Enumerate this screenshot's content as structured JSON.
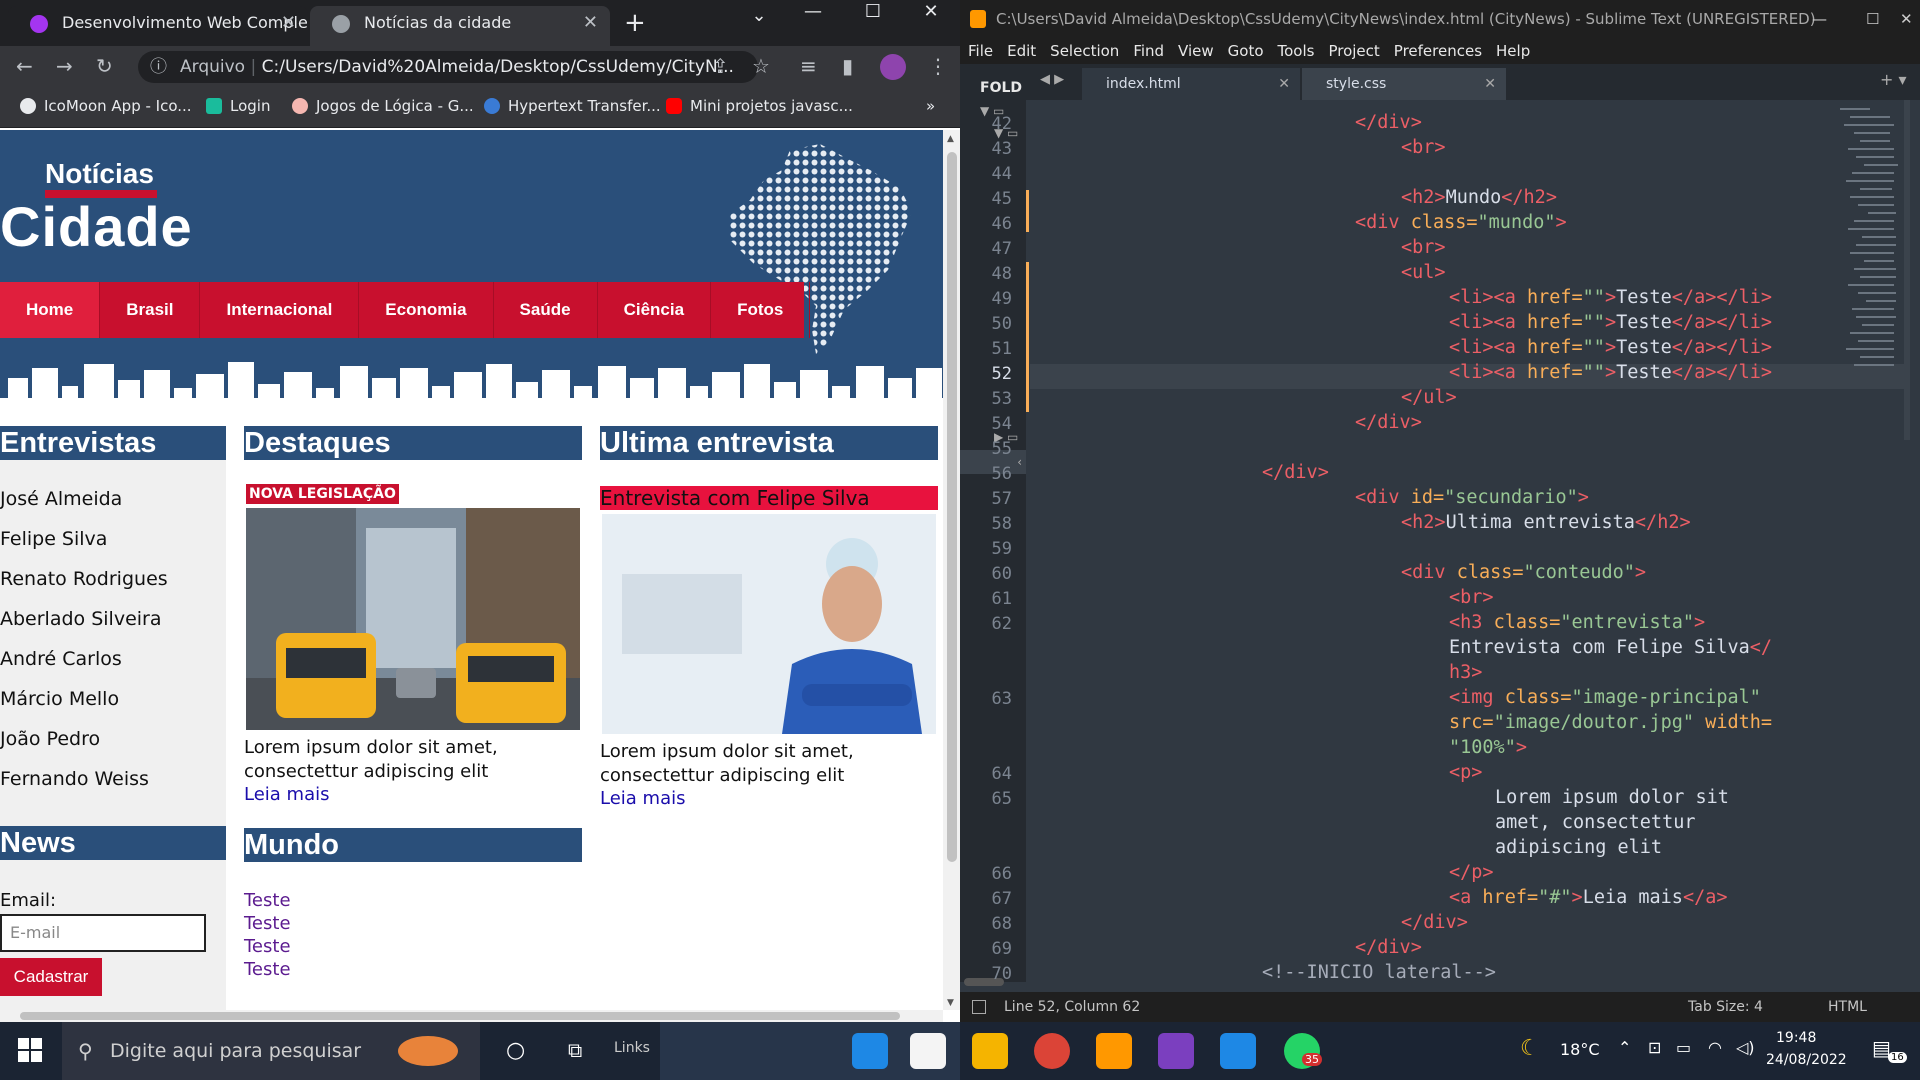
{
  "browser": {
    "tabs": [
      {
        "title": "Desenvolvimento Web Completo"
      },
      {
        "title": "Notícias da cidade"
      }
    ],
    "address": {
      "label": "Arquivo",
      "url": "C:/Users/David%20Almeida/Desktop/CssUdemy/CityN..."
    },
    "bookmarks": [
      "IcoMoon App - Ico...",
      "Login",
      "Jogos de Lógica - G...",
      "Hypertext Transfer...",
      "Mini projetos javasc..."
    ]
  },
  "site": {
    "logo_top": "Notícias",
    "logo_bottom": "Cidade",
    "nav": [
      "Home",
      "Brasil",
      "Internacional",
      "Economia",
      "Saúde",
      "Ciência",
      "Fotos"
    ],
    "entrevistas": {
      "title": "Entrevistas",
      "names": [
        "José Almeida",
        "Felipe Silva",
        "Renato Rodrigues",
        "Aberlado Silveira",
        "André Carlos",
        "Márcio Mello",
        "João Pedro",
        "Fernando Weiss"
      ]
    },
    "news": {
      "title": "News",
      "email_label": "Email:",
      "email_placeholder": "E-mail",
      "button": "Cadastrar"
    },
    "destaques": {
      "title": "Destaques",
      "tag": "NOVA LEGISLAÇÃO",
      "lorem_1": "Lorem ipsum dolor sit amet,",
      "lorem_2": "consectettur adipiscing elit",
      "more": "Leia mais"
    },
    "mundo": {
      "title": "Mundo",
      "items": [
        "Teste",
        "Teste",
        "Teste",
        "Teste"
      ]
    },
    "ultima": {
      "title": "Ultima entrevista",
      "tag": "Entrevista com Felipe Silva",
      "lorem_1": "Lorem ipsum dolor sit amet,",
      "lorem_2": "consectettur adipiscing elit",
      "more": "Leia mais"
    }
  },
  "editor": {
    "title": "C:\\Users\\David Almeida\\Desktop\\CssUdemy\\CityNews\\index.html (CityNews) - Sublime Text (UNREGISTERED)",
    "menu": [
      "File",
      "Edit",
      "Selection",
      "Find",
      "View",
      "Goto",
      "Tools",
      "Project",
      "Preferences",
      "Help"
    ],
    "sidebar_label": "FOLD",
    "tabs": [
      "index.html",
      "style.css"
    ],
    "status_left": "Line 52, Column 62",
    "tab_size": "Tab Size: 4",
    "syntax": "HTML",
    "line_numbers": [
      "42",
      "43",
      "44",
      "45",
      "46",
      "47",
      "48",
      "49",
      "50",
      "51",
      "52",
      "53",
      "54",
      "55",
      "56",
      "57",
      "58",
      "59",
      "60",
      "61",
      "62",
      "",
      "63",
      "",
      "64",
      "65",
      "",
      "",
      "66",
      "67",
      "68",
      "69",
      "70"
    ],
    "lines": {
      "l42": "</div>",
      "l43": "<br>",
      "l45a": "<h2>",
      "l45b": "Mundo",
      "l45c": "</h2>",
      "l46a": "<div ",
      "l46b": "class=",
      "l46c": "\"mundo\"",
      "l46d": ">",
      "l47": "<br>",
      "l48": "<ul>",
      "li_a": "<li><a ",
      "li_b": "href=",
      "li_c": "\"\"",
      "li_d": ">",
      "li_e": "Teste",
      "li_f": "</a></li>",
      "l53": "</ul>",
      "l54": "</div>",
      "l56": "</div>",
      "l57a": "<div ",
      "l57b": "id=",
      "l57c": "\"secundario\"",
      "l57d": ">",
      "l58a": "<h2>",
      "l58b": "Ultima entrevista",
      "l58c": "</h2>",
      "l60a": "<div ",
      "l60b": "class=",
      "l60c": "\"conteudo\"",
      "l60d": ">",
      "l61": "<br>",
      "l62a": "<h3 ",
      "l62b": "class=",
      "l62c": "\"entrevista\"",
      "l62d": ">",
      "l62e": "Entrevista com Felipe Silva",
      "l62f": "</",
      "l62g": "h3>",
      "l63a": "<img ",
      "l63b": "class=",
      "l63c": "\"image-principal\"",
      "l63d": "src=",
      "l63e": "\"image/doutor.jpg\"",
      "l63f": " width=",
      "l63g": "\"100%\"",
      "l63h": ">",
      "l64": "<p>",
      "l65a": "Lorem ipsum dolor sit",
      "l65b": "amet, consectettur",
      "l65c": "adipiscing elit",
      "l66": "</p>",
      "l67a": "<a ",
      "l67b": "href=",
      "l67c": "\"#\"",
      "l67d": ">",
      "l67e": "Leia mais",
      "l67f": "</a>",
      "l68": "</div>",
      "l69": "</div>",
      "l70": "<!--INICIO lateral-->"
    }
  },
  "taskbar": {
    "search_placeholder": "Digite aqui para pesquisar",
    "links": "Links",
    "temperature": "18°C",
    "time": "19:48",
    "date": "24/08/2022",
    "notifications": "16",
    "whatsapp_badge": "35"
  },
  "colors": {
    "brand_blue": "#2a4f7a",
    "brand_red": "#c8102e"
  }
}
